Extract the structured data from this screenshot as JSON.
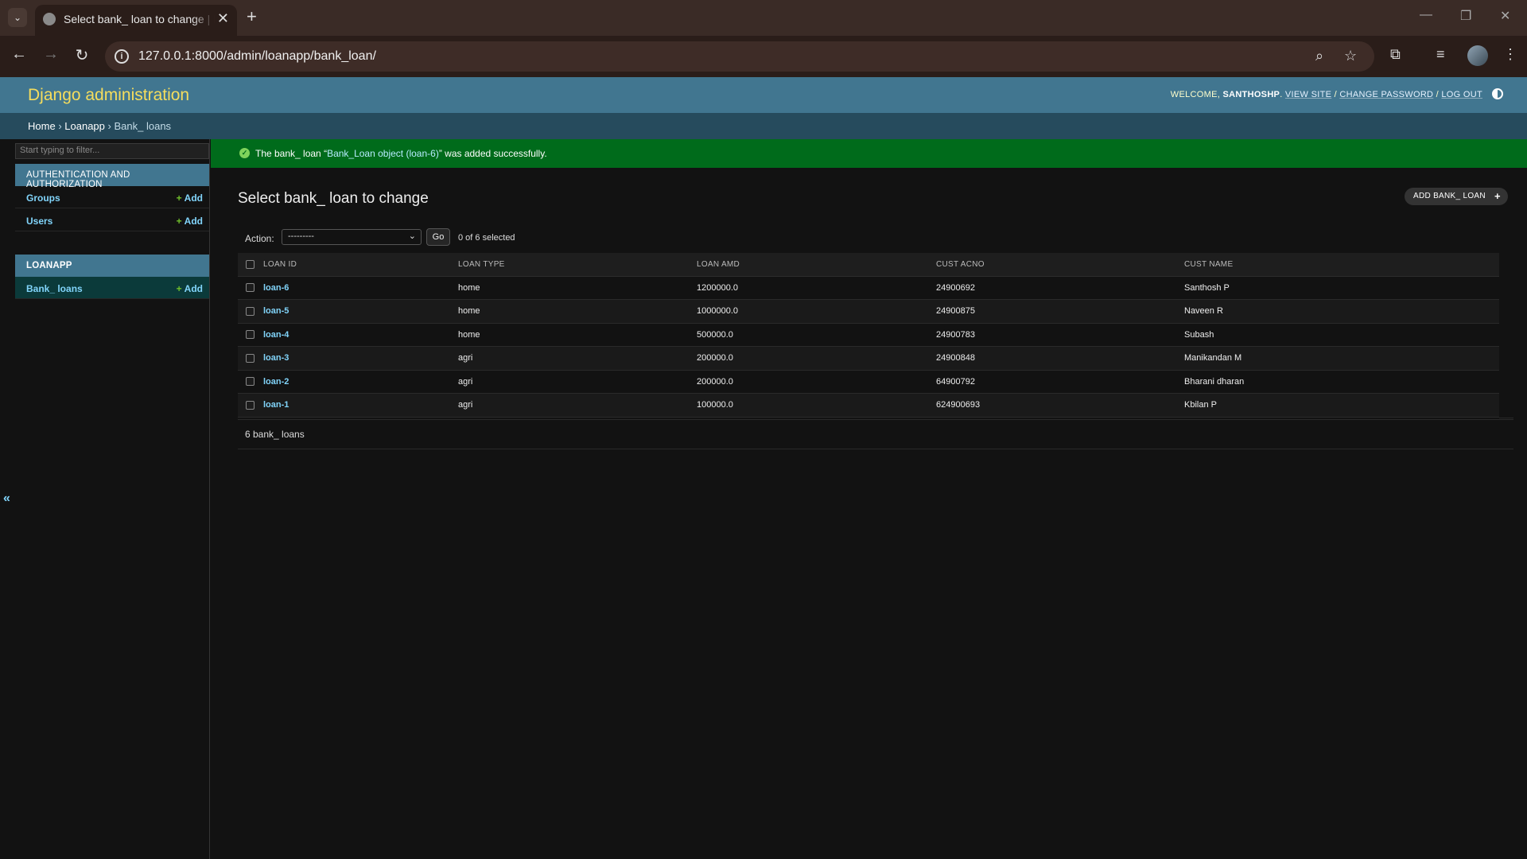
{
  "browser": {
    "tab_title": "Select bank_ loan to change | Django site admin",
    "url": "127.0.0.1:8000/admin/loanapp/bank_loan/"
  },
  "header": {
    "branding": "Django administration",
    "welcome": "WELCOME,",
    "username": "SANTHOSHP",
    "view_site": "VIEW SITE",
    "change_password": "CHANGE PASSWORD",
    "log_out": "LOG OUT",
    "sep": "/"
  },
  "breadcrumbs": {
    "home": "Home",
    "app": "Loanapp",
    "current": "Bank_ loans",
    "sep": "›"
  },
  "sidebar": {
    "filter_placeholder": "Start typing to filter...",
    "modules": [
      {
        "caption": "AUTHENTICATION AND AUTHORIZATION",
        "models": [
          {
            "name": "Groups",
            "add": "Add"
          },
          {
            "name": "Users",
            "add": "Add"
          }
        ]
      },
      {
        "caption": "LOANAPP",
        "models": [
          {
            "name": "Bank_ loans",
            "add": "Add"
          }
        ]
      }
    ],
    "collapse_label": "«"
  },
  "message": {
    "prefix": "The bank_ loan “",
    "link": "Bank_Loan object (loan-6)",
    "suffix": "” was added successfully."
  },
  "main": {
    "title": "Select bank_ loan to change",
    "add_button": "ADD BANK_ LOAN",
    "action_label": "Action:",
    "action_selected": "---------",
    "go": "Go",
    "selection_count": "0 of 6 selected",
    "columns": [
      "LOAN ID",
      "LOAN TYPE",
      "LOAN AMD",
      "CUST ACNO",
      "CUST NAME"
    ],
    "rows": [
      {
        "id": "loan-6",
        "type": "home",
        "amount": "1200000.0",
        "acno": "24900692",
        "name": "Santhosh P"
      },
      {
        "id": "loan-5",
        "type": "home",
        "amount": "1000000.0",
        "acno": "24900875",
        "name": "Naveen R"
      },
      {
        "id": "loan-4",
        "type": "home",
        "amount": "500000.0",
        "acno": "24900783",
        "name": "Subash"
      },
      {
        "id": "loan-3",
        "type": "agri",
        "amount": "200000.0",
        "acno": "24900848",
        "name": "Manikandan M"
      },
      {
        "id": "loan-2",
        "type": "agri",
        "amount": "200000.0",
        "acno": "64900792",
        "name": "Bharani dharan"
      },
      {
        "id": "loan-1",
        "type": "agri",
        "amount": "100000.0",
        "acno": "624900693",
        "name": "Kbilan P"
      }
    ],
    "paginator": "6 bank_ loans"
  },
  "colors": {
    "header_bg": "#417690",
    "branding": "#f5dd5d",
    "breadcrumbs_bg": "#264b5d",
    "success_bg": "#006b1b",
    "link": "#81d4fa"
  }
}
